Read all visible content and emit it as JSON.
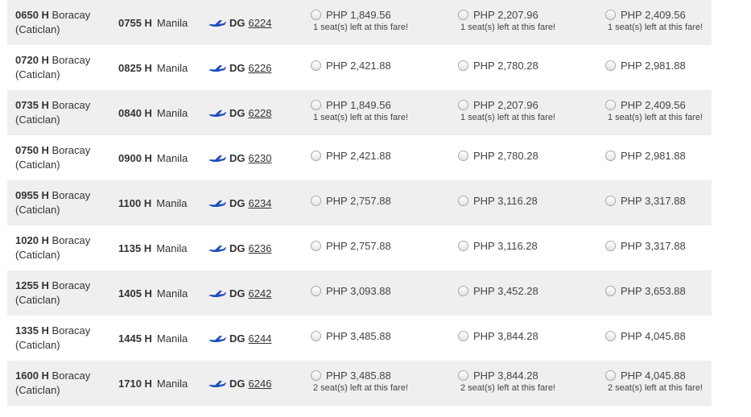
{
  "carrier_code": "DG",
  "colors": {
    "row_shade": "#efefef",
    "plane_blue": "#1f4fb8"
  },
  "flights": [
    {
      "dep_time": "0650 H",
      "dep_city": "Boracay",
      "dep_airport": "(Caticlan)",
      "arr_time": "0755 H",
      "arr_city": "Manila",
      "flight_num": "6224",
      "fares": [
        {
          "price": "PHP 1,849.56",
          "seats": "1 seat(s) left at this fare!"
        },
        {
          "price": "PHP 2,207.96",
          "seats": "1 seat(s) left at this fare!"
        },
        {
          "price": "PHP 2,409.56",
          "seats": "1 seat(s) left at this fare!"
        }
      ]
    },
    {
      "dep_time": "0720 H",
      "dep_city": "Boracay",
      "dep_airport": "(Caticlan)",
      "arr_time": "0825 H",
      "arr_city": "Manila",
      "flight_num": "6226",
      "fares": [
        {
          "price": "PHP 2,421.88",
          "seats": ""
        },
        {
          "price": "PHP 2,780.28",
          "seats": ""
        },
        {
          "price": "PHP 2,981.88",
          "seats": ""
        }
      ]
    },
    {
      "dep_time": "0735 H",
      "dep_city": "Boracay",
      "dep_airport": "(Caticlan)",
      "arr_time": "0840 H",
      "arr_city": "Manila",
      "flight_num": "6228",
      "fares": [
        {
          "price": "PHP 1,849.56",
          "seats": "1 seat(s) left at this fare!"
        },
        {
          "price": "PHP 2,207.96",
          "seats": "1 seat(s) left at this fare!"
        },
        {
          "price": "PHP 2,409.56",
          "seats": "1 seat(s) left at this fare!"
        }
      ]
    },
    {
      "dep_time": "0750 H",
      "dep_city": "Boracay",
      "dep_airport": "(Caticlan)",
      "arr_time": "0900 H",
      "arr_city": "Manila",
      "flight_num": "6230",
      "fares": [
        {
          "price": "PHP 2,421.88",
          "seats": ""
        },
        {
          "price": "PHP 2,780.28",
          "seats": ""
        },
        {
          "price": "PHP 2,981.88",
          "seats": ""
        }
      ]
    },
    {
      "dep_time": "0955 H",
      "dep_city": "Boracay",
      "dep_airport": "(Caticlan)",
      "arr_time": "1100 H",
      "arr_city": "Manila",
      "flight_num": "6234",
      "fares": [
        {
          "price": "PHP 2,757.88",
          "seats": ""
        },
        {
          "price": "PHP 3,116.28",
          "seats": ""
        },
        {
          "price": "PHP 3,317.88",
          "seats": ""
        }
      ]
    },
    {
      "dep_time": "1020 H",
      "dep_city": "Boracay",
      "dep_airport": "(Caticlan)",
      "arr_time": "1135 H",
      "arr_city": "Manila",
      "flight_num": "6236",
      "fares": [
        {
          "price": "PHP 2,757.88",
          "seats": ""
        },
        {
          "price": "PHP 3,116.28",
          "seats": ""
        },
        {
          "price": "PHP 3,317.88",
          "seats": ""
        }
      ]
    },
    {
      "dep_time": "1255 H",
      "dep_city": "Boracay",
      "dep_airport": "(Caticlan)",
      "arr_time": "1405 H",
      "arr_city": "Manila",
      "flight_num": "6242",
      "fares": [
        {
          "price": "PHP 3,093.88",
          "seats": ""
        },
        {
          "price": "PHP 3,452.28",
          "seats": ""
        },
        {
          "price": "PHP 3,653.88",
          "seats": ""
        }
      ]
    },
    {
      "dep_time": "1335 H",
      "dep_city": "Boracay",
      "dep_airport": "(Caticlan)",
      "arr_time": "1445 H",
      "arr_city": "Manila",
      "flight_num": "6244",
      "fares": [
        {
          "price": "PHP 3,485.88",
          "seats": ""
        },
        {
          "price": "PHP 3,844.28",
          "seats": ""
        },
        {
          "price": "PHP 4,045.88",
          "seats": ""
        }
      ]
    },
    {
      "dep_time": "1600 H",
      "dep_city": "Boracay",
      "dep_airport": "(Caticlan)",
      "arr_time": "1710 H",
      "arr_city": "Manila",
      "flight_num": "6246",
      "fares": [
        {
          "price": "PHP 3,485.88",
          "seats": "2 seat(s) left at this fare!"
        },
        {
          "price": "PHP 3,844.28",
          "seats": "2 seat(s) left at this fare!"
        },
        {
          "price": "PHP 4,045.88",
          "seats": "2 seat(s) left at this fare!"
        }
      ]
    }
  ]
}
